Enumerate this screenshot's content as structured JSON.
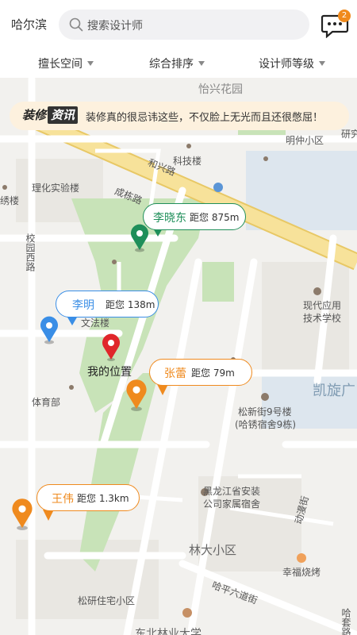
{
  "header": {
    "city": "哈尔滨",
    "search_placeholder": "搜索设计师",
    "message_badge": "2"
  },
  "filters": [
    {
      "label": "擅长空间"
    },
    {
      "label": "综合排序"
    },
    {
      "label": "设计师等级"
    }
  ],
  "banner": {
    "logo_part1": "装修",
    "logo_part2": "资讯",
    "text": "装修真的很忌讳这些，不仅脸上无光而且还很憋屈！"
  },
  "my_location_label": "我的位置",
  "designers": [
    {
      "name": "李晓东",
      "distance": "距您 875m",
      "color": "#1f8f5a"
    },
    {
      "name": "李明",
      "distance": "距您 138m",
      "color": "#3a8ee6"
    },
    {
      "name": "张蕾",
      "distance": "距您 79m",
      "color": "#ef8a1e"
    },
    {
      "name": "王伟",
      "distance": "距您 1.3km",
      "color": "#ef8a1e"
    }
  ],
  "map_labels": {
    "yixing": "怡兴花园",
    "mingzhong": "明仲小区",
    "yanjiu": "研究",
    "heshing": "和兴路",
    "kejilou": "科技楼",
    "lihua": "理化实验楼",
    "xiulou": "绣楼",
    "chengzhi": "成栋路",
    "xiaoyuan": "校园西路",
    "yingyong": "现代应用",
    "jishu": "技术学校",
    "wenfa": "文法楼",
    "tiyu": "体育部",
    "kaixuan": "凯旋广",
    "songxin": "松新街9号楼",
    "haxiu": "(哈锈宿舍9栋)",
    "heilong1": "黑龙江省安装",
    "heilong2": "公司家属宿舍",
    "linda": "林大小区",
    "dongfu": "动漫街",
    "xingfu": "幸福烧烤",
    "songyan": "松研住宅小区",
    "hapingliu": "哈平六道街",
    "dongbei": "东北林业大学",
    "hatao": "哈套路"
  },
  "colors": {
    "pin_red": "#e0262a",
    "green": "#1f8f5a",
    "blue": "#3a8ee6",
    "orange": "#ef8a1e",
    "park": "#c8e3b8",
    "road_major": "#f7e29a"
  }
}
